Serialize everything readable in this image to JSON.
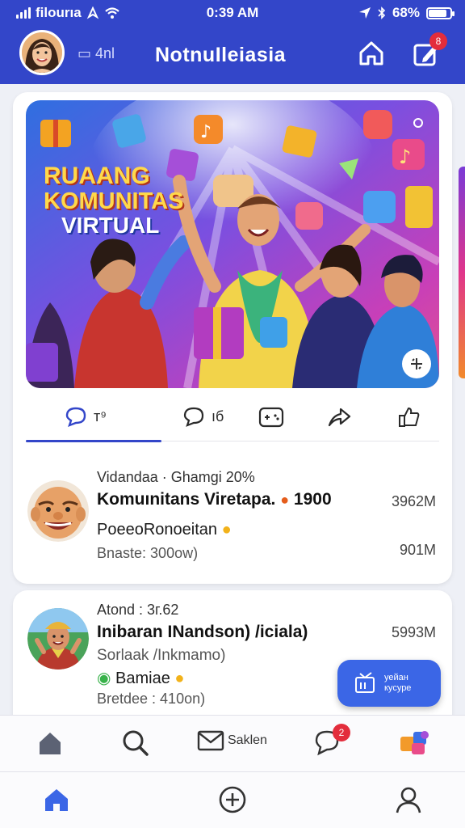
{
  "status_bar": {
    "carrier": "filourıa",
    "time": "0:39 AM",
    "battery": "68%"
  },
  "header": {
    "sub_label": "▭ 4nl",
    "title": "NotnuIleiasia",
    "notification_count": "8"
  },
  "hero": {
    "line1": "RUAANG",
    "line2": "KOMUNITAS",
    "line3": "VIRTUAL"
  },
  "actions": {
    "comment_count": "т⁹",
    "reply_count": "ıб"
  },
  "post1": {
    "meta": "Vidandaa · Ghamgi 20%",
    "title": "Komuınitans Viretapa.",
    "title_count": "1900",
    "side_value": "3962М",
    "subtitle": "PoeeoRonoeitan",
    "footer": "Bnaste: 300ow)",
    "footer_value": "901М"
  },
  "post2": {
    "meta": "Atond : 3г.62",
    "title": "Inibaran INandson) /iciala)",
    "side_value": "5993М",
    "subtitle": "Sorlaak /Inkmamo)",
    "tag": "Bamiae",
    "footer": "Bretdee : 410on)"
  },
  "fab": {
    "line1": "уейан",
    "line2": "кусуре"
  },
  "nav_top": {
    "inbox_label": "Saklen",
    "chat_badge": "2"
  },
  "colors": {
    "primary": "#3346c9",
    "accent_button": "#3b66e6",
    "badge": "#e32d3c"
  },
  "icons": [
    "signal-icon",
    "wifi-icon",
    "location-arrow-icon",
    "bluetooth-icon",
    "battery-icon",
    "home-icon",
    "edit-icon",
    "chat-icon",
    "comment-icon",
    "gamepad-icon",
    "share-icon",
    "like-icon",
    "search-icon",
    "mail-icon",
    "puzzle-icon",
    "plus-circle-icon",
    "user-icon"
  ]
}
